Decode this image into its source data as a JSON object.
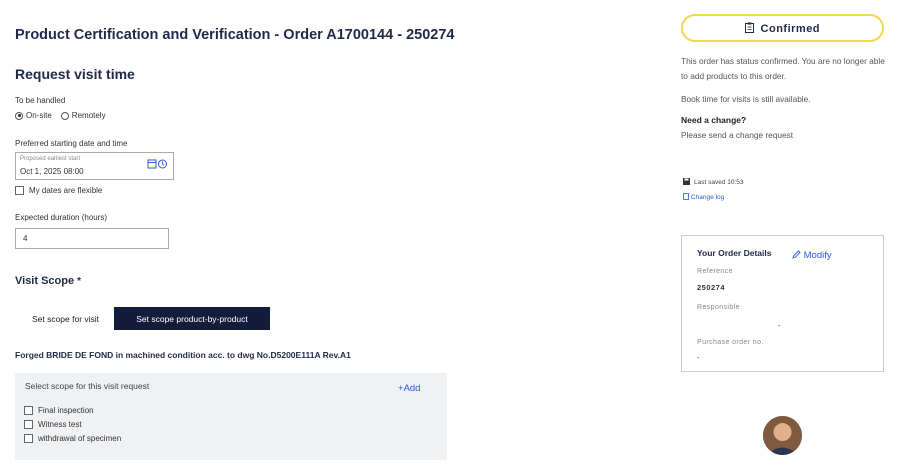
{
  "page": {
    "title": "Product Certification and Verification - Order A1700144 - 250274"
  },
  "visit": {
    "section_title": "Request visit time",
    "handled_label": "To be handled",
    "option_onsite": "On-site",
    "option_remote": "Remotely",
    "selected_option": "On-site",
    "date_label": "Preferred starting date and time",
    "date_placeholder": "Proposed earliest start",
    "date_value": "Oct 1, 2025   08:00",
    "flexible_label": "My dates are flexible",
    "flexible_checked": false,
    "duration_label": "Expected duration (hours)",
    "duration_value": "4"
  },
  "scope": {
    "title": "Visit Scope",
    "required_marker": "*",
    "tab_visit": "Set scope for visit",
    "tab_product": "Set scope product-by-product",
    "active_tab": "Set scope product-by-product",
    "product_title": "Forged BRIDE DE FOND in machined condition acc. to dwg No.D5200E111A Rev.A1",
    "select_label": "Select scope for this visit request",
    "add_label": "Add",
    "items": [
      {
        "label": "Final inspection",
        "checked": false
      },
      {
        "label": "Witness test",
        "checked": false
      },
      {
        "label": "withdrawal of specimen",
        "checked": false
      }
    ]
  },
  "status": {
    "label": "Confirmed",
    "description": "This order has status confirmed. You are no longer able to add products to this order.",
    "book_time": "Book time for visits is still available.",
    "need_change_title": "Need a change?",
    "need_change_text": "Please send a change request",
    "last_saved": "Last saved 10:53",
    "change_log": "Change log"
  },
  "order_details": {
    "title": "Your Order Details",
    "modify_label": "Modify",
    "reference_label": "Reference",
    "reference_value": "250274",
    "responsible_label": "Responsible",
    "responsible_value": "-",
    "po_label": "Purchase order no.",
    "po_value": "-"
  },
  "colors": {
    "accent_blue": "#2a5bd7",
    "dark_navy": "#131c3b",
    "confirmed_border": "#f3d64b"
  }
}
